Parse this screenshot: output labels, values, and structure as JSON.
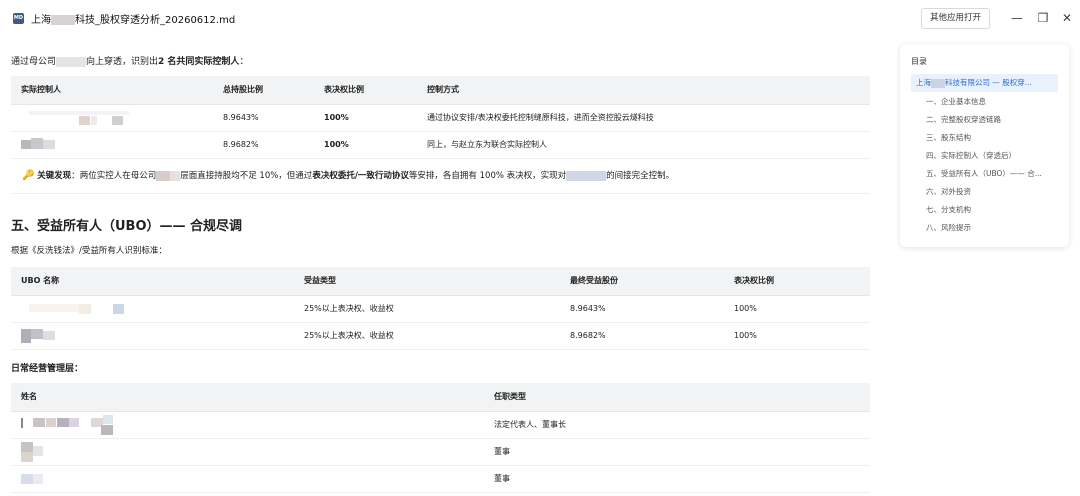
{
  "window": {
    "file_icon_label": "MD",
    "title_prefix": "上海",
    "title_suffix": "科技_股权穿透分析_20260612.md",
    "open_with_label": "其他应用打开"
  },
  "doc": {
    "intro_prefix": "通过母公司",
    "intro_mid": "向上穿透，识别出",
    "intro_bold": "2 名共同实际控制人",
    "intro_end": "：",
    "controller_table": {
      "headers": [
        "实际控制人",
        "总持股比例",
        "表决权比例",
        "控制方式"
      ],
      "rows": [
        {
          "share": "8.9643%",
          "vote": "100%",
          "method": "通过协议安排/表决权委托控制缝原科技，进而全资控股云燧科技"
        },
        {
          "share": "8.9682%",
          "vote": "100%",
          "method": "同上，与赵立东为联合实际控制人"
        }
      ]
    },
    "finding": {
      "label": "关键发现",
      "colon": "：",
      "t1": "两位实控人在母公司",
      "t2": "层面直接持股均不足 10%，但通过",
      "bold": "表决权委托/一致行动协议",
      "t3": "等安排，各自拥有 100% 表决权，实现对",
      "t4": "的间接完全控制。"
    },
    "section5_title": "五、受益所有人（UBO）—— 合规尽调",
    "ubo_standard": "根据《反洗钱法》/受益所有人识别标准：",
    "ubo_table": {
      "headers": [
        "UBO 名称",
        "受益类型",
        "最终受益股份",
        "表决权比例"
      ],
      "rows": [
        {
          "type": "25%以上表决权、收益权",
          "share": "8.9643%",
          "vote": "100%"
        },
        {
          "type": "25%以上表决权、收益权",
          "share": "8.9682%",
          "vote": "100%"
        }
      ]
    },
    "mgmt_title": "日常经营管理层：",
    "mgmt_table": {
      "headers": [
        "姓名",
        "任职类型"
      ],
      "rows": [
        {
          "role": "法定代表人、董事长"
        },
        {
          "role": "董事"
        },
        {
          "role": "董事"
        }
      ]
    }
  },
  "toc": {
    "title": "目录",
    "active_prefix": "上海",
    "active_suffix": "科技有限公司 — 股权穿...",
    "items": [
      "一、企业基本信息",
      "二、完整股权穿透链路",
      "三、股东结构",
      "四、实际控制人（穿透后）",
      "五、受益所有人（UBO）—— 合...",
      "六、对外投资",
      "七、分支机构",
      "八、风险提示"
    ]
  },
  "colors": {
    "accent": "#2f6ad0",
    "toc_active_bg": "#e9f1fd",
    "table_header_bg": "#f2f3f5"
  }
}
